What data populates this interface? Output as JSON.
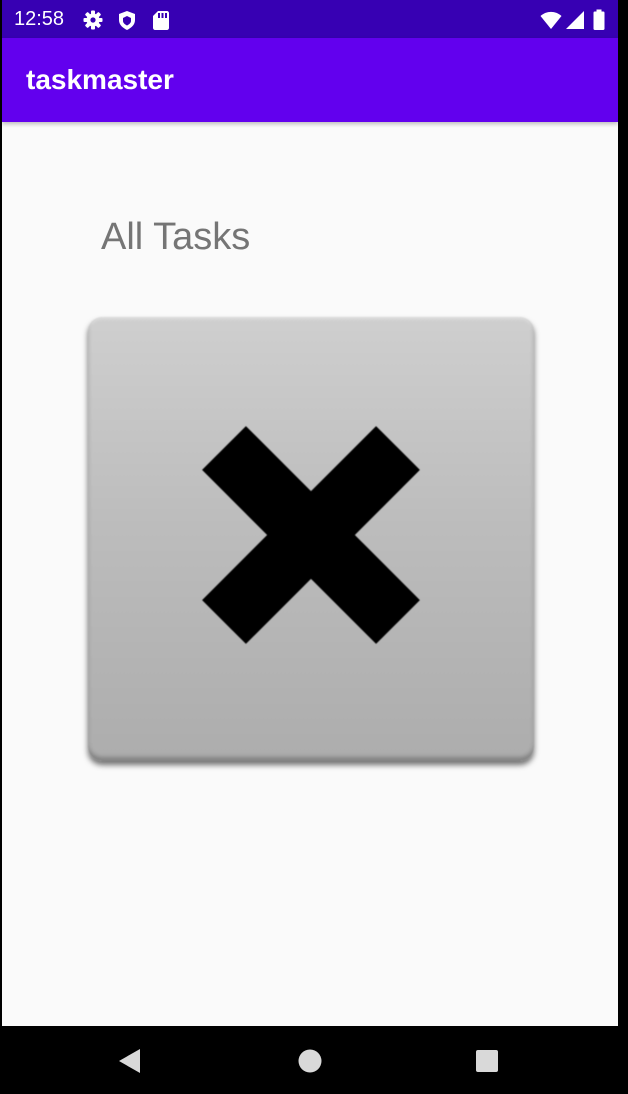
{
  "status_bar": {
    "time": "12:58",
    "icons_left": [
      "gear-icon",
      "shield-icon",
      "sd-card-icon"
    ],
    "icons_right": [
      "wifi-icon",
      "signal-icon",
      "battery-icon"
    ]
  },
  "app_bar": {
    "title": "taskmaster",
    "color": "#6200ee",
    "status_color": "#3700b3"
  },
  "main": {
    "heading": "All Tasks",
    "image": {
      "icon": "close-icon"
    }
  },
  "nav_bar": {
    "buttons": [
      "back-icon",
      "home-icon",
      "recents-icon"
    ]
  }
}
